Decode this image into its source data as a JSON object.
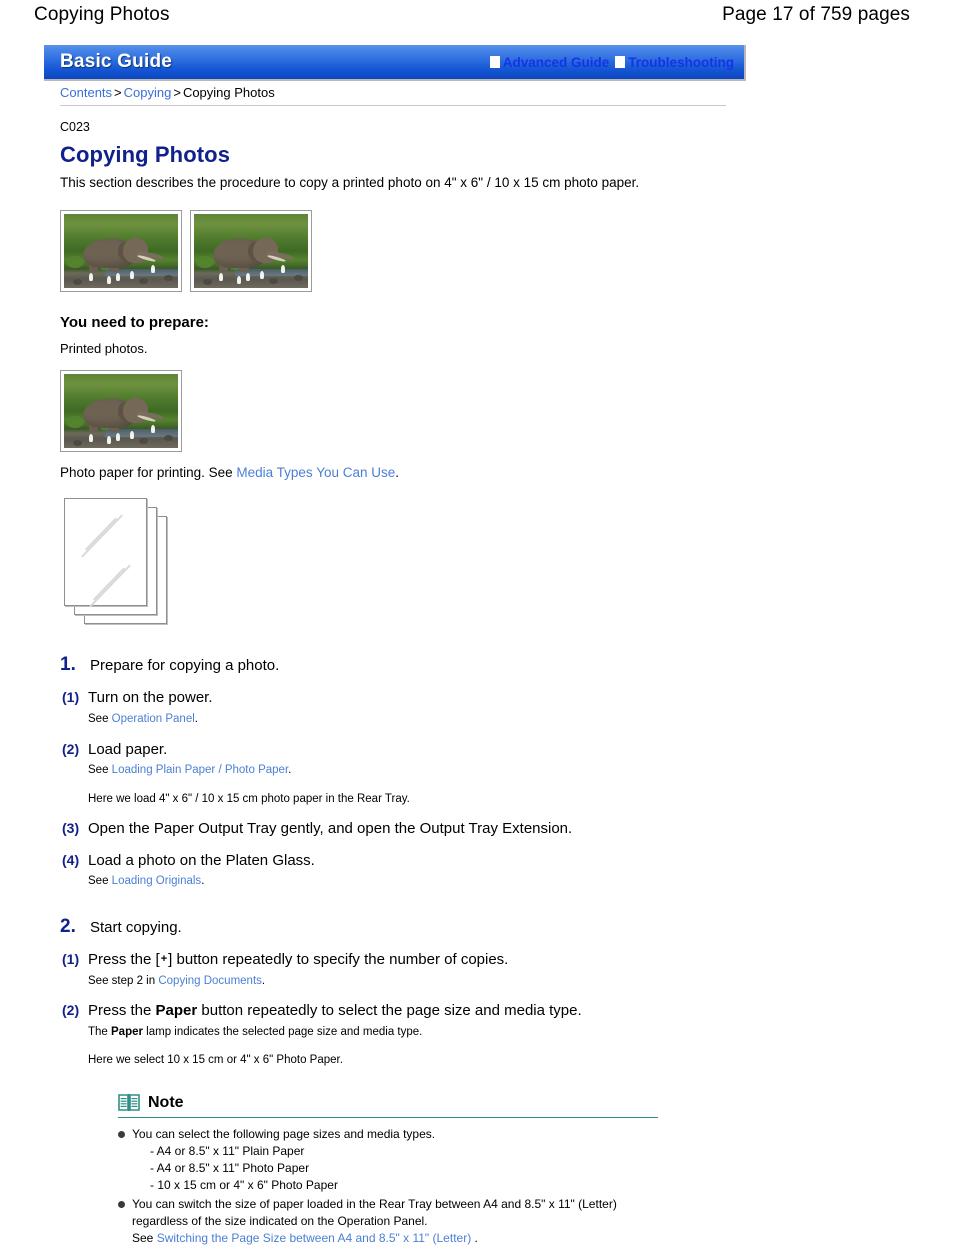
{
  "page_header": {
    "doc_title": "Copying Photos",
    "page_count": "Page 17 of 759 pages"
  },
  "guide_bar": {
    "brand": "Basic Guide",
    "links": [
      {
        "label": "Advanced Guide",
        "icon": "white-square-icon"
      },
      {
        "label": "Troubleshooting",
        "icon": "white-square-icon"
      }
    ]
  },
  "breadcrumb": {
    "items": [
      {
        "label": "Contents",
        "link": true
      },
      {
        "label": "Copying",
        "link": true
      },
      {
        "label": "Copying Photos",
        "link": false
      }
    ],
    "separator": ">"
  },
  "article": {
    "doc_code": "C023",
    "title": "Copying Photos",
    "lead": "This section describes the procedure to copy a printed photo on 4\" x 6\" / 10 x 15 cm photo paper.",
    "photos": [
      {
        "alt": "printed-photo-elephant-1"
      },
      {
        "alt": "printed-photo-elephant-2"
      }
    ]
  },
  "prepare": {
    "title": "You need to prepare:",
    "item1": "Printed photos.",
    "photo": {
      "alt": "printed-photo-elephant-sample"
    },
    "paper_line_before": "Photo paper for printing. See",
    "paper_link": "Media Types You Can Use",
    "paper_line_after": ".",
    "paper_illustration": "stack-of-photo-paper"
  },
  "steps": [
    {
      "number": "1.",
      "title": "Prepare for copying a photo.",
      "substeps": [
        {
          "number": "(1)",
          "title": "Turn on the power.",
          "note_prefix": "See",
          "note_link": "Operation Panel",
          "note_suffix": "."
        },
        {
          "number": "(2)",
          "title": "Load paper.",
          "note_prefix": "See",
          "note_link": "Loading Plain Paper / Photo Paper",
          "note_suffix": ".",
          "extra_note": "Here we load 4\" x 6\" / 10 x 15 cm photo paper in the Rear Tray."
        },
        {
          "number": "(3)",
          "title": "Open the Paper Output Tray gently, and open the Output Tray Extension."
        },
        {
          "number": "(4)",
          "title": "Load a photo on the Platen Glass.",
          "note_prefix": "See",
          "note_link": "Loading Originals",
          "note_suffix": "."
        }
      ]
    },
    {
      "number": "2.",
      "title": "Start copying.",
      "substeps": [
        {
          "number": "(1)",
          "title_a": "Press the [",
          "title_key": "+",
          "title_b": "] button repeatedly to specify the number of copies.",
          "note_prefix": "See step 2 in",
          "note_link": "Copying Documents",
          "note_suffix": "."
        },
        {
          "number": "(2)",
          "title_a": "Press the ",
          "title_kw": "Paper",
          "title_b": " button repeatedly to select the page size and media type.",
          "note_a": "The ",
          "note_kw": "Paper",
          "note_b": " lamp indicates the selected page size and media type.",
          "extra_note": "Here we select 10 x 15 cm or 4\" x 6\" Photo Paper."
        }
      ]
    }
  ],
  "note_box": {
    "icon": "open-book-icon",
    "label": "Note",
    "items": [
      {
        "text": "You can select the following page sizes and media types.",
        "sublines": [
          "- A4 or 8.5\" x 11\" Plain Paper",
          "- A4 or 8.5\" x 11\" Photo Paper",
          "- 10 x 15 cm or 4\" x 6\" Photo Paper"
        ]
      },
      {
        "text": "You can switch the size of paper loaded in the Rear Tray between A4 and 8.5\" x 11\" (Letter) regardless of the size indicated on the Operation Panel.",
        "see_prefix": "See",
        "see_link": "Switching the Page Size between A4 and 8.5\" x 11\" (Letter)",
        "see_suffix": "."
      }
    ]
  },
  "colors": {
    "heading_blue": "#10218b",
    "link_blue": "#4a7fd6",
    "bar_blue": "#1456d4",
    "bar_link_blue": "#1533e8",
    "note_teal": "#2e8f86",
    "rule_gray": "#c6c9cb"
  }
}
